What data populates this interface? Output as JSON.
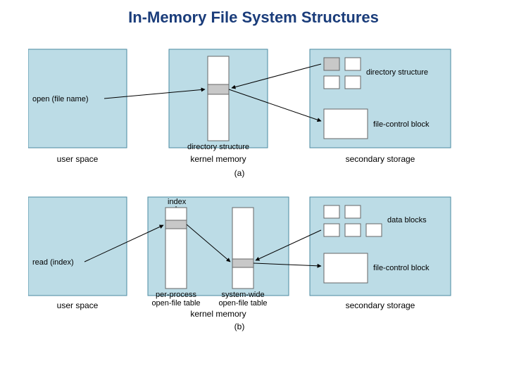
{
  "title": "In-Memory File System Structures",
  "columns": [
    "user space",
    "kernel memory",
    "secondary storage"
  ],
  "panel_a": {
    "tag": "(a)",
    "user_call": "open (file name)",
    "kernel_box": "directory structure",
    "storage_top": "directory structure",
    "storage_bottom": "file-control block"
  },
  "panel_b": {
    "tag": "(b)",
    "user_call": "read (index)",
    "index_label": "index",
    "kernel_box1": "per-process\nopen-file table",
    "kernel_box2": "system-wide\nopen-file table",
    "storage_top": "data blocks",
    "storage_bottom": "file-control block"
  }
}
